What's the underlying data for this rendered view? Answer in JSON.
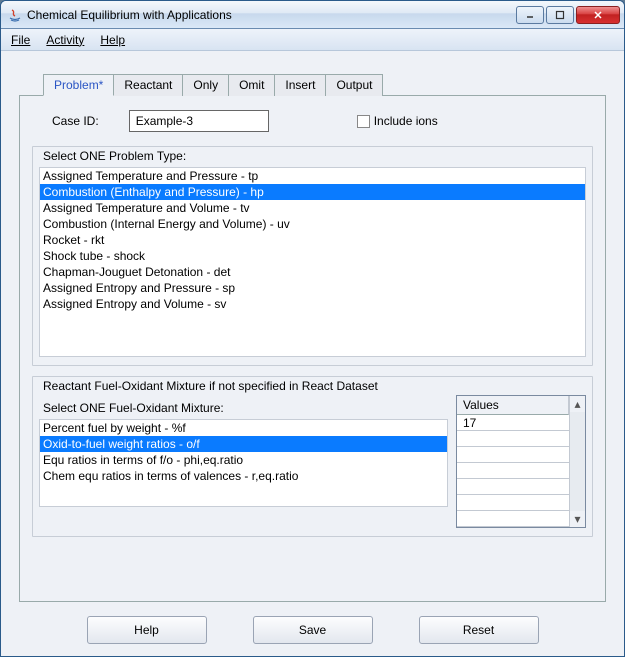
{
  "window": {
    "title": "Chemical Equilibrium with Applications",
    "min_label": "–",
    "max_label": "□",
    "close_label": "×"
  },
  "menu": {
    "file": "File",
    "activity": "Activity",
    "help": "Help"
  },
  "tabs": {
    "problem": "Problem*",
    "reactant": "Reactant",
    "only": "Only",
    "omit": "Omit",
    "insert": "Insert",
    "output": "Output"
  },
  "case": {
    "label": "Case ID:",
    "value": "Example-3",
    "include_ions_label": "Include ions"
  },
  "problem_types": {
    "legend": "Select ONE Problem Type:",
    "items": [
      "Assigned Temperature and Pressure - tp",
      "Combustion (Enthalpy and Pressure) - hp",
      "Assigned Temperature and Volume    - tv",
      "Combustion (Internal Energy and Volume) - uv",
      "Rocket - rkt",
      "Shock tube  - shock",
      "Chapman-Jouguet Detonation - det",
      "Assigned Entropy and Pressure  - sp",
      "Assigned Entropy and Volume  - sv"
    ],
    "selected_index": 1
  },
  "mixture": {
    "outer_legend": "Reactant Fuel-Oxidant Mixture if not specified in React Dataset",
    "inner_legend": "Select ONE Fuel-Oxidant Mixture:",
    "items": [
      "Percent fuel by weight - %f",
      "Oxid-to-fuel weight ratios - o/f",
      "Equ ratios in terms of f/o - phi,eq.ratio",
      "Chem equ ratios in terms of valences - r,eq.ratio"
    ],
    "selected_index": 1,
    "values_header": "Values",
    "values": [
      "17",
      "",
      "",
      "",
      "",
      "",
      ""
    ]
  },
  "buttons": {
    "help": "Help",
    "save": "Save",
    "reset": "Reset"
  }
}
